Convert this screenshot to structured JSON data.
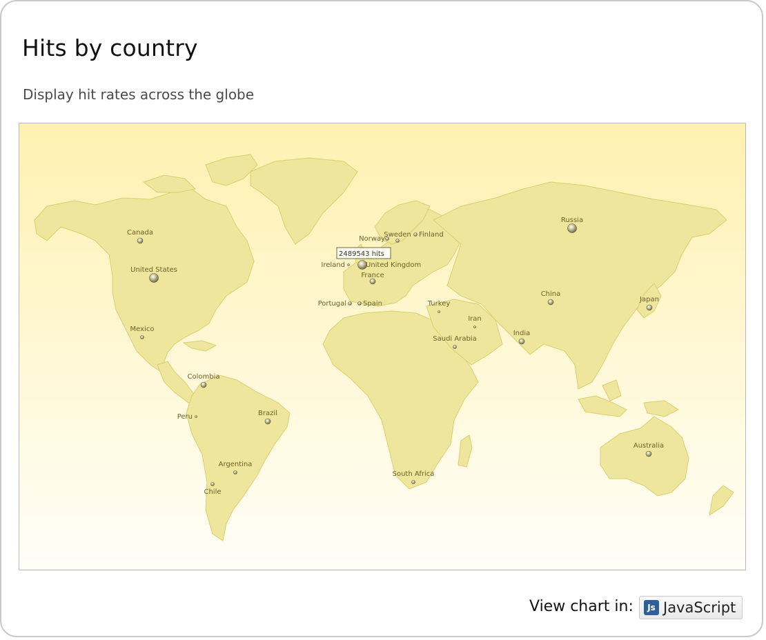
{
  "header": {
    "title": "Hits by country",
    "subtitle": "Display hit rates across the globe"
  },
  "map": {
    "background_top": "#fff1b0",
    "background_bottom": "#fffef8",
    "land_color": "#eee69c",
    "tooltip": {
      "text": "2489543 hits",
      "country": "United Kingdom"
    },
    "markers": [
      {
        "name": "Canada",
        "size": "medium"
      },
      {
        "name": "United States",
        "size": "large"
      },
      {
        "name": "Mexico",
        "size": "small"
      },
      {
        "name": "Colombia",
        "size": "medium"
      },
      {
        "name": "Peru",
        "size": "tiny"
      },
      {
        "name": "Brazil",
        "size": "medium"
      },
      {
        "name": "Argentina",
        "size": "small"
      },
      {
        "name": "Chile",
        "size": "small"
      },
      {
        "name": "Norway",
        "size": "small"
      },
      {
        "name": "Sweden",
        "size": "small"
      },
      {
        "name": "Finland",
        "size": "small"
      },
      {
        "name": "Ireland",
        "size": "tiny"
      },
      {
        "name": "United Kingdom",
        "size": "large"
      },
      {
        "name": "France",
        "size": "medium"
      },
      {
        "name": "Portugal",
        "size": "small"
      },
      {
        "name": "Spain",
        "size": "small"
      },
      {
        "name": "Turkey",
        "size": "tiny"
      },
      {
        "name": "Iran",
        "size": "tiny"
      },
      {
        "name": "Saudi Arabia",
        "size": "small"
      },
      {
        "name": "Russia",
        "size": "large"
      },
      {
        "name": "China",
        "size": "medium"
      },
      {
        "name": "India",
        "size": "medium"
      },
      {
        "name": "Japan",
        "size": "medium"
      },
      {
        "name": "South Africa",
        "size": "small"
      },
      {
        "name": "Australia",
        "size": "medium"
      }
    ]
  },
  "footer": {
    "label": "View chart in:",
    "button_label": "JavaScript",
    "button_icon": "js-icon"
  }
}
